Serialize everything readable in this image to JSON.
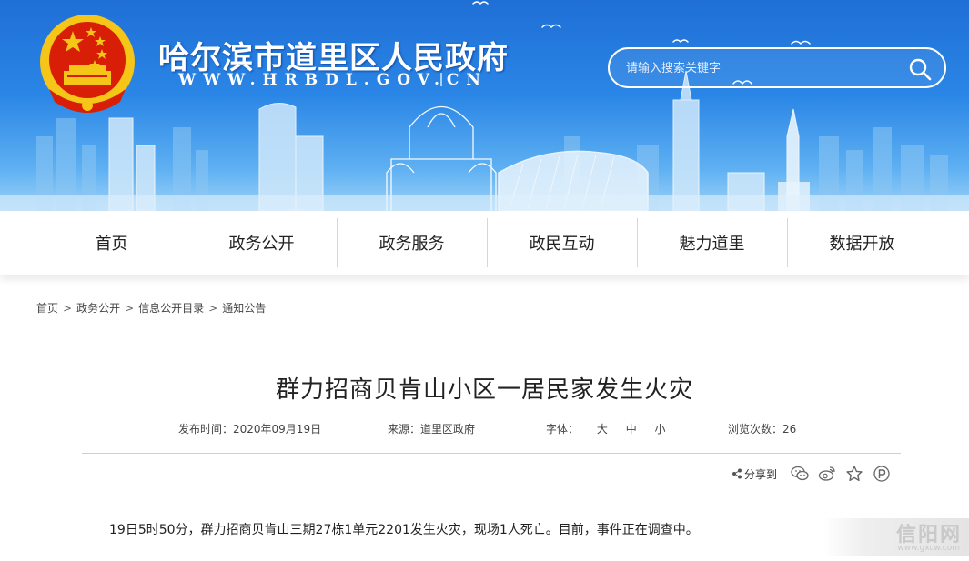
{
  "header": {
    "site_title": "哈尔滨市道里区人民政府",
    "site_url": "WWW.HRBDL.GOV.CN",
    "search_placeholder": "请输入搜索关键字"
  },
  "nav": {
    "items": [
      {
        "label": "首页"
      },
      {
        "label": "政务公开"
      },
      {
        "label": "政务服务"
      },
      {
        "label": "政民互动"
      },
      {
        "label": "魅力道里"
      },
      {
        "label": "数据开放"
      }
    ]
  },
  "breadcrumb": {
    "items": [
      "首页",
      "政务公开",
      "信息公开目录",
      "通知公告"
    ],
    "separator": ">"
  },
  "article": {
    "title": "群力招商贝肯山小区一居民家发生火灾",
    "publish_time": "发布时间：2020年09月19日",
    "source": "来源：道里区政府",
    "font_label": "字体：",
    "font_sizes": [
      "大",
      "中",
      "小"
    ],
    "views": "浏览次数：26",
    "share_label": "分享到",
    "body": "19日5时50分，群力招商贝肯山三期27栋1单元2201发生火灾，现场1人死亡。目前，事件正在调查中。"
  },
  "watermark": {
    "text": "信阳网",
    "url": "www.gxcw.com"
  },
  "colors": {
    "header_top": "#1f6fd6",
    "header_bottom": "#9fd2f8",
    "emblem_red": "#d81e06",
    "emblem_gold": "#f5c518"
  }
}
